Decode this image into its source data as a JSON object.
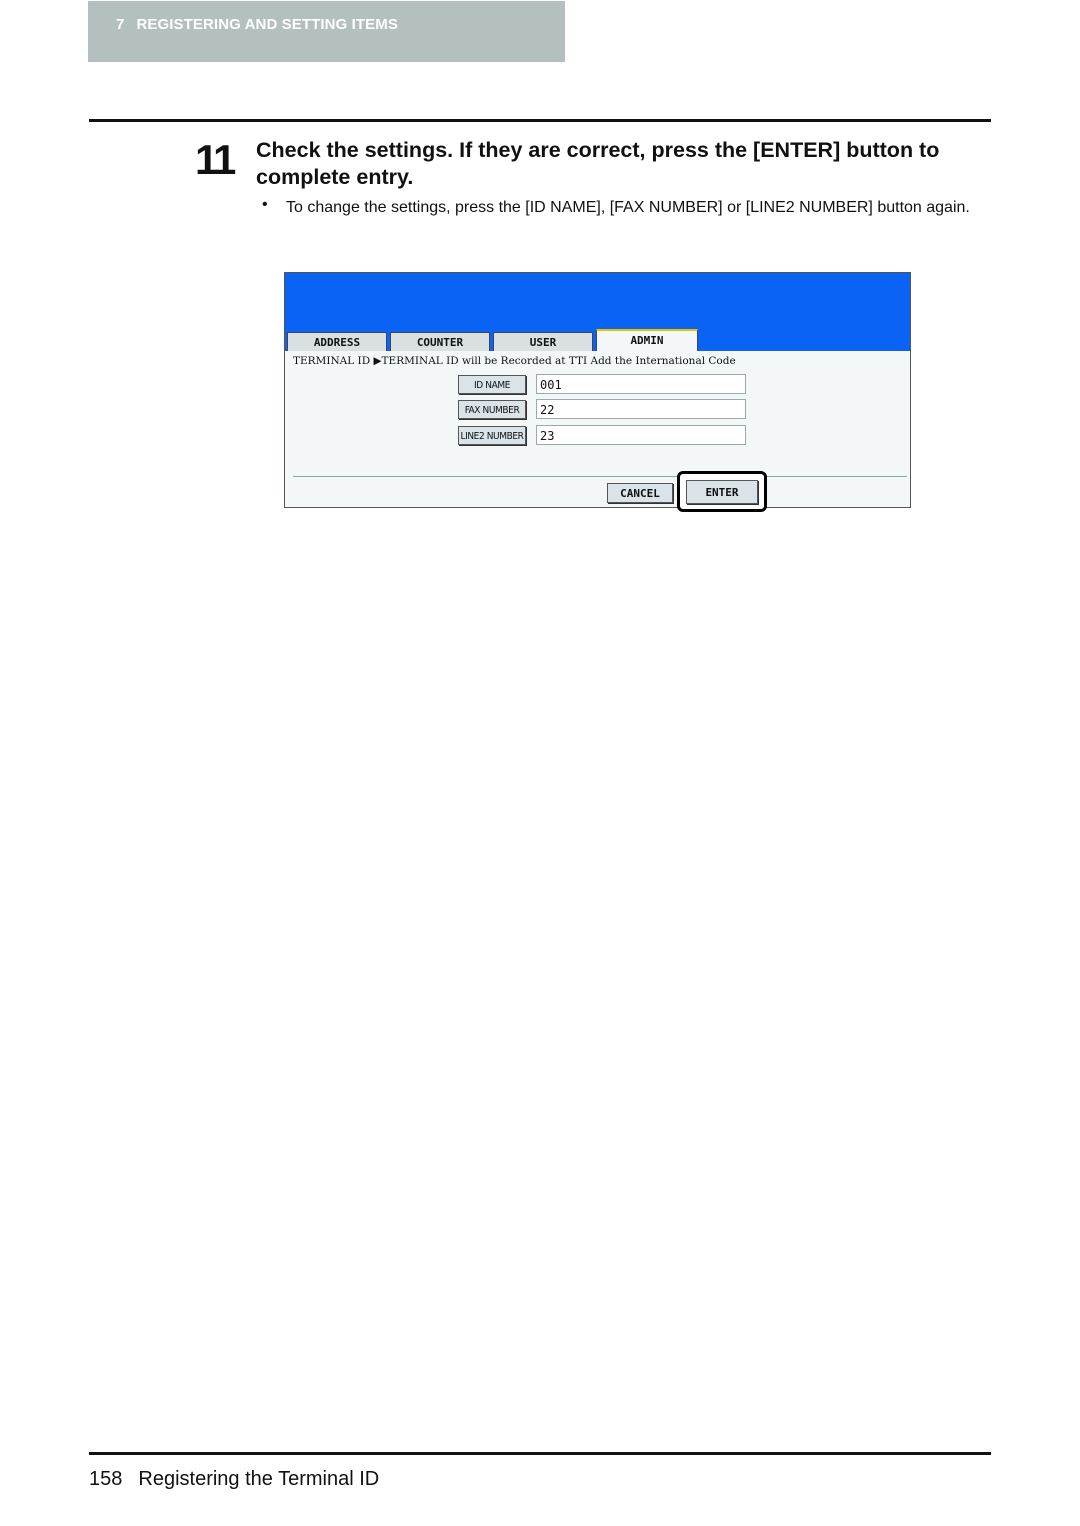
{
  "header": {
    "chapter_number": "7",
    "chapter_title": "REGISTERING AND SETTING ITEMS"
  },
  "step": {
    "number": "11",
    "title": "Check the settings. If they are correct, press the [ENTER] button to complete entry.",
    "bullet_symbol": "•",
    "bullet_text": "To change the settings, press the [ID NAME], [FAX NUMBER] or [LINE2 NUMBER] button again."
  },
  "screen": {
    "colors": {
      "title_bar": "#0a63f5",
      "active_tab_accent": "#e8c000"
    },
    "tabs": [
      {
        "label": "ADDRESS",
        "active": false
      },
      {
        "label": "COUNTER",
        "active": false
      },
      {
        "label": "USER",
        "active": false
      },
      {
        "label": "ADMIN",
        "active": true
      }
    ],
    "info_line": "TERMINAL ID ▶TERMINAL ID will be Recorded at TTI Add the International Code",
    "fields": [
      {
        "button": "ID NAME",
        "value": "001"
      },
      {
        "button": "FAX NUMBER",
        "value": "22"
      },
      {
        "button": "LINE2 NUMBER",
        "value": "23"
      }
    ],
    "cancel_label": "CANCEL",
    "enter_label": "ENTER"
  },
  "footer": {
    "page_number": "158",
    "section_title": "Registering the Terminal ID"
  }
}
